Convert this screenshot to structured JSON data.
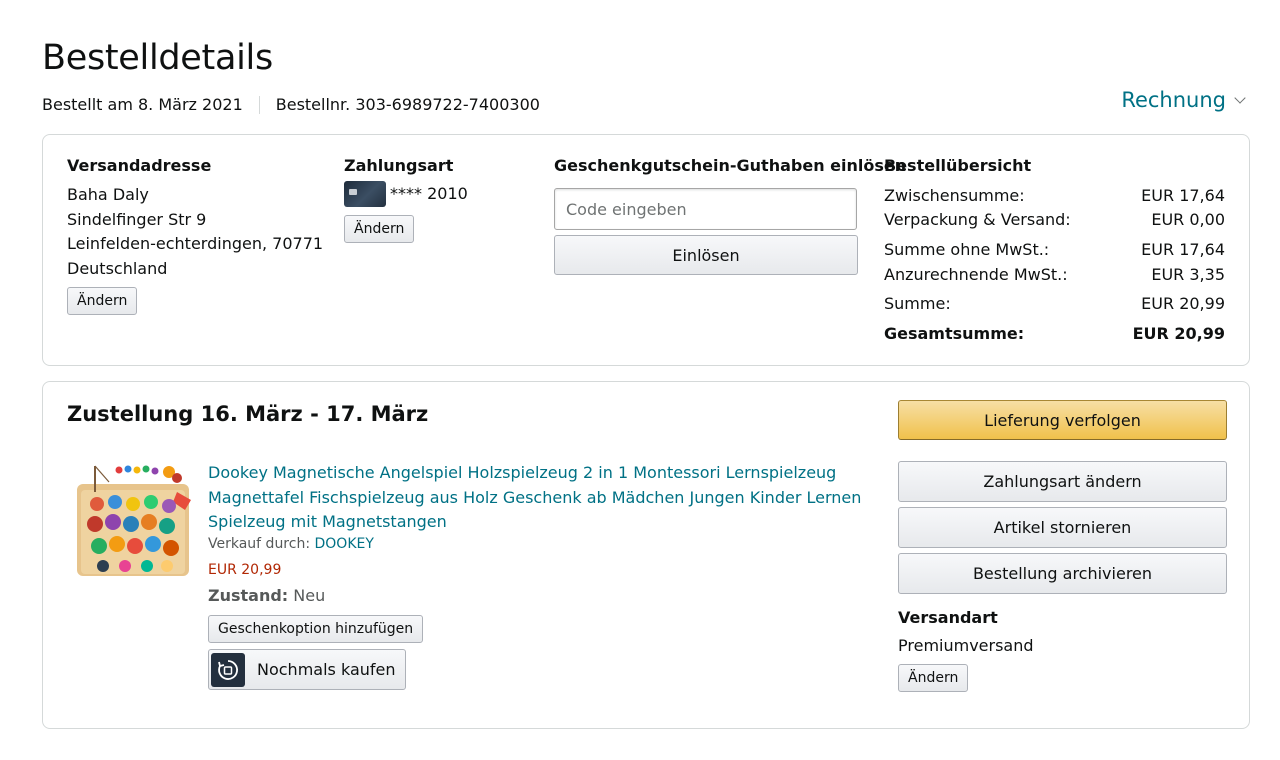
{
  "header": {
    "title": "Bestelldetails",
    "ordered_date": "Bestellt am 8. März 2021",
    "order_number": "Bestellnr. 303-6989722-7400300",
    "invoice_label": "Rechnung"
  },
  "address": {
    "heading": "Versandadresse",
    "lines": [
      "Baha Daly",
      "Sindelfinger Str 9",
      "Leinfelden-echterdingen, 70771",
      "Deutschland"
    ],
    "change_label": "Ändern"
  },
  "payment": {
    "heading": "Zahlungsart",
    "card_masked": "**** 2010",
    "card_icon": "credit-card-icon",
    "change_label": "Ändern"
  },
  "giftcard": {
    "heading": "Geschenkgutschein-Guthaben einlösen",
    "placeholder": "Code eingeben",
    "redeem_label": "Einlösen"
  },
  "summary": {
    "heading": "Bestellübersicht",
    "rows": [
      {
        "label": "Zwischensumme:",
        "value": "EUR 17,64"
      },
      {
        "label": "Verpackung & Versand:",
        "value": "EUR 0,00"
      },
      {
        "label": "Summe ohne MwSt.:",
        "value": "EUR 17,64"
      },
      {
        "label": "Anzurechnende MwSt.:",
        "value": "EUR 3,35"
      },
      {
        "label": "Summe:",
        "value": "EUR 20,99"
      }
    ],
    "total_label": "Gesamtsumme:",
    "total_value": "EUR 20,99"
  },
  "delivery": {
    "title": "Zustellung 16. März - 17. März",
    "product": {
      "title": "Dookey Magnetische Angelspiel Holzspielzeug 2 in 1 Montessori Lernspielzeug Magnettafel Fischspielzeug aus Holz Geschenk ab Mädchen Jungen Kinder Lernen Spielzeug mit Magnetstangen",
      "seller_prefix": "Verkauf durch:",
      "seller": "DOOKEY",
      "price": "EUR 20,99",
      "condition_label": "Zustand:",
      "condition_value": "Neu",
      "gift_label": "Geschenkoption hinzufügen",
      "buy_again_label": "Nochmals kaufen",
      "buy_again_icon": "buy-again-icon"
    },
    "actions": {
      "track": "Lieferung verfolgen",
      "change_payment": "Zahlungsart ändern",
      "cancel": "Artikel stornieren",
      "archive": "Bestellung archivieren"
    },
    "shipping": {
      "heading": "Versandart",
      "method": "Premiumversand",
      "change_label": "Ändern"
    }
  },
  "colors": {
    "link": "#007185",
    "price": "#b12704",
    "primary_button": "#f0c14b",
    "border": "#d5d9d9"
  }
}
